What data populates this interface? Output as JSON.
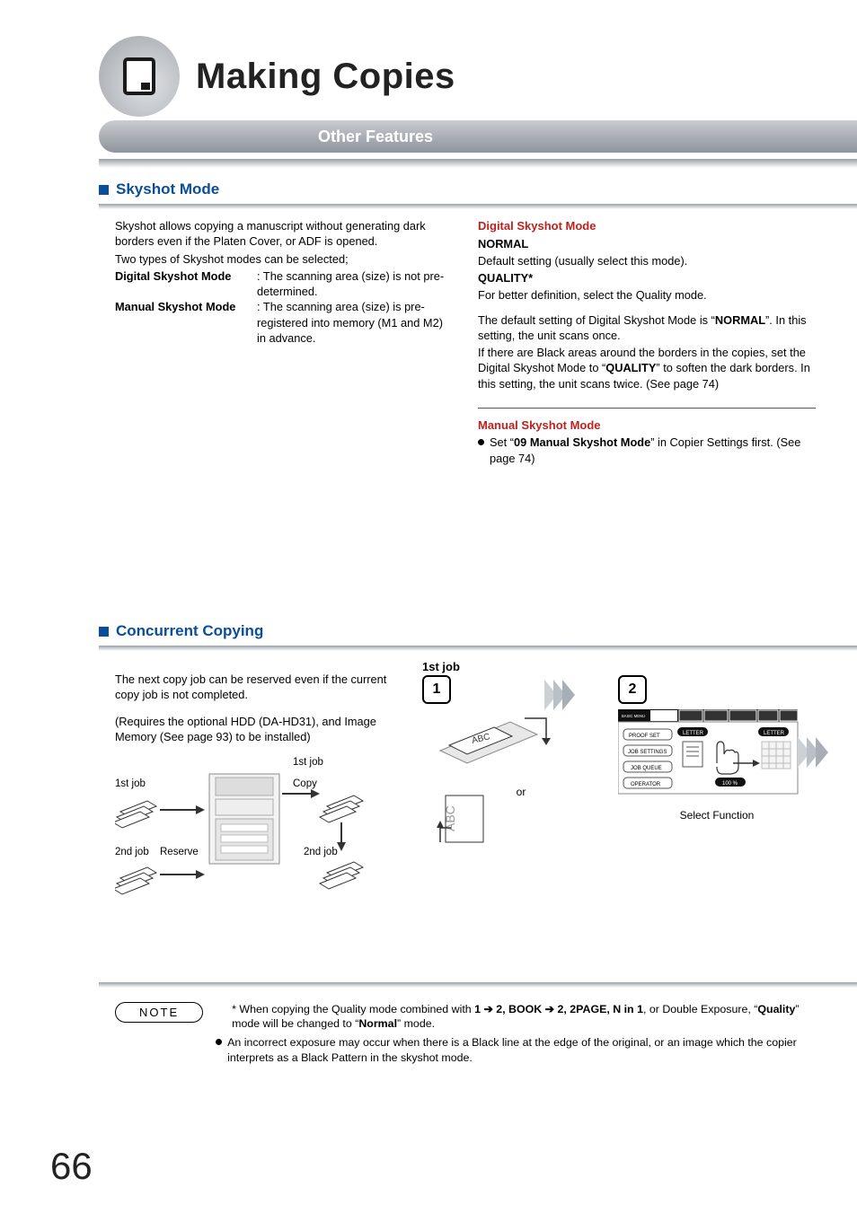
{
  "header": {
    "title": "Making Copies",
    "subtitle": "Other Features"
  },
  "skyshot": {
    "heading": "Skyshot Mode",
    "intro1": "Skyshot allows copying a manuscript without generating dark borders even if the Platen Cover, or ADF is opened.",
    "intro2": "Two types of Skyshot modes can be selected;",
    "digital_label": "Digital Skyshot Mode",
    "digital_desc": ": The scanning area (size) is not pre-determined.",
    "manual_label": "Manual Skyshot Mode",
    "manual_desc": ": The scanning area (size) is pre-registered into memory (M1 and M2) in advance.",
    "digital_heading": "Digital Skyshot Mode",
    "normal_label": "NORMAL",
    "normal_desc": "Default setting (usually select this mode).",
    "quality_label": "QUALITY*",
    "quality_desc": "For better definition, select the Quality mode.",
    "default_para1": "The default setting of Digital Skyshot Mode is “",
    "default_bold1": "NORMAL",
    "default_para1b": "”. In this setting, the unit scans once.",
    "default_para2a": "If there are Black areas around the borders in the copies, set the Digital Skyshot Mode to “",
    "default_bold2": "QUALITY",
    "default_para2b": "” to soften the dark borders. In this setting, the unit scans twice. (See page 74)",
    "manual_heading": "Manual Skyshot Mode",
    "manual_bullet_a": "Set “",
    "manual_bullet_bold": "09 Manual Skyshot Mode",
    "manual_bullet_b": "” in Copier Settings first. (See page 74)"
  },
  "concurrent": {
    "heading": "Concurrent Copying",
    "line1": "The next copy job can be reserved even if the current copy job is not completed.",
    "line2": "(Requires the optional HDD (DA-HD31), and Image Memory (See page 93) to be installed)",
    "labels": {
      "first_job_top": "1st job",
      "first_job_side": "1st job",
      "second_job": "2nd job",
      "reserve": "Reserve",
      "copy": "Copy",
      "or": "or",
      "select_function": "Select Function",
      "step1": "1",
      "step2": "2"
    }
  },
  "note": {
    "label": "NOTE",
    "item1_a": "* When copying the Quality mode combined with ",
    "item1_b1": "1 ➔ 2, BOOK ➔ 2, 2PAGE, N in 1",
    "item1_c": ", or Double Exposure, “",
    "item1_b2": "Quality",
    "item1_d": "” mode will be changed to “",
    "item1_b3": "Normal",
    "item1_e": "” mode.",
    "item2": "An incorrect exposure may occur when there is a Black line at the edge of the original, or an image which the copier interprets as a Black Pattern in the skyshot mode."
  },
  "page_number": "66"
}
